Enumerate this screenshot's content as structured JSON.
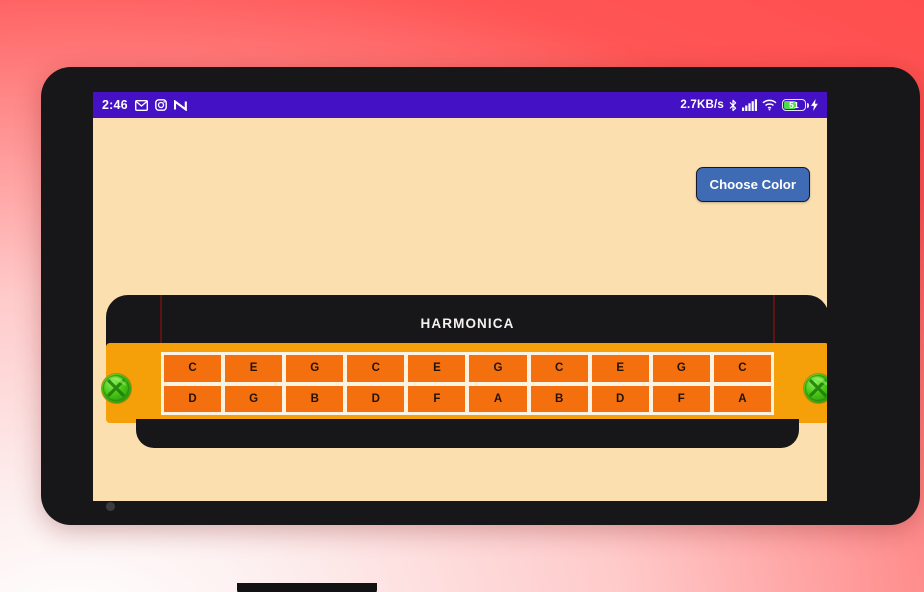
{
  "background": {
    "gradient_from": "#ffffff",
    "gradient_to": "#ff4d4d"
  },
  "phone": {
    "frame_color": "#171719",
    "screen_bg": "#fcdfaf"
  },
  "status_bar": {
    "time": "2:46",
    "bg_color": "#4511c4",
    "left_icons": [
      {
        "name": "gmail-icon",
        "glyph": "envelope"
      },
      {
        "name": "instagram-icon",
        "glyph": "camera"
      },
      {
        "name": "nequi-icon",
        "glyph": "N"
      }
    ],
    "network_speed": "2.7KB/s",
    "right_icons": [
      {
        "name": "bluetooth-icon",
        "glyph": "bluetooth"
      },
      {
        "name": "signal-icon",
        "glyph": "bars"
      },
      {
        "name": "wifi-icon",
        "glyph": "wifi"
      }
    ],
    "battery_percent": "51",
    "battery_fill_color": "#4ddc4d",
    "charging": true
  },
  "app": {
    "choose_color_label": "Choose Color",
    "choose_color_bg": "#3f6bb5",
    "harmonica": {
      "title": "HARMONICA",
      "body_color": "#f5a009",
      "cell_color": "#f4700f",
      "plate_color": "#171719",
      "rows": [
        {
          "name": "blow-row",
          "notes": [
            "C",
            "E",
            "G",
            "C",
            "E",
            "G",
            "C",
            "E",
            "G",
            "C"
          ]
        },
        {
          "name": "draw-row",
          "notes": [
            "D",
            "G",
            "B",
            "D",
            "F",
            "A",
            "B",
            "D",
            "F",
            "A"
          ]
        }
      ],
      "knobs": [
        {
          "name": "knob-left",
          "color": "#46c516"
        },
        {
          "name": "knob-right",
          "color": "#46c516"
        }
      ]
    }
  }
}
